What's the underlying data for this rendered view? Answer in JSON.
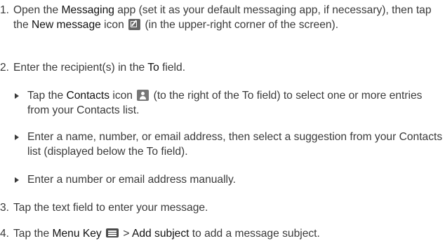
{
  "steps": [
    {
      "num": "1.",
      "t1": "Open the ",
      "b1": "Messaging",
      "t2": " app (set it as your default messaging app, if necessary), then tap the ",
      "b2": "New message",
      "t3": " icon ",
      "icon": "new-message-icon",
      "t4": " (in the upper-right corner of the screen)."
    },
    {
      "num": "2.",
      "t1": "Enter the recipient(s) in the ",
      "b1": "To",
      "t2": " field."
    },
    {
      "num": "3.",
      "t1": "Tap the text field to enter your message."
    },
    {
      "num": "4.",
      "t1": "Tap the ",
      "b1": "Menu Key",
      "icon": "menu-key-icon",
      "t2": " > ",
      "b2": "Add subject",
      "t3": " to add a message subject."
    }
  ],
  "bullets": [
    {
      "t1": "Tap the ",
      "b1": "Contacts",
      "t2": " icon ",
      "icon": "contacts-icon",
      "t3": " (to the right of the To field) to select one or more entries from your Contacts list."
    },
    {
      "t1": "Enter a name, number, or email address, then select a suggestion from your Contacts list (displayed below the To field)."
    },
    {
      "t1": "Enter a number or email address manually."
    }
  ]
}
